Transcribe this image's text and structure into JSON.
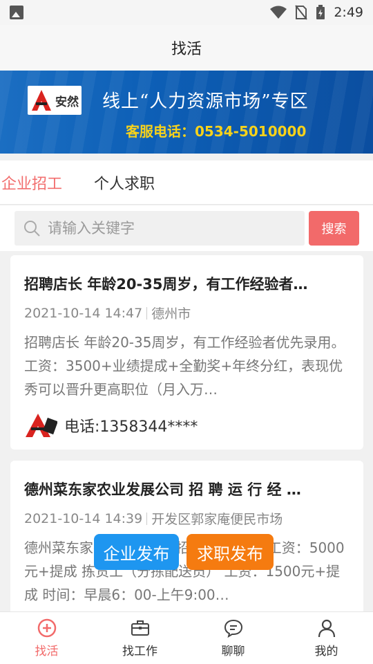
{
  "status_bar": {
    "time": "2:49"
  },
  "title": "找活",
  "banner": {
    "logo_text": "安然",
    "slogan": "线上“人力资源市场”专区",
    "phone": "客服电话：0534-5010000"
  },
  "tabs": [
    {
      "label": "企业招工",
      "active": true
    },
    {
      "label": "个人求职",
      "active": false
    }
  ],
  "search": {
    "placeholder": "请输入关键字",
    "button": "搜索"
  },
  "listings": [
    {
      "title": "招聘店长 年龄20-35周岁，有工作经验者…",
      "date": "2021-10-14 14:47",
      "location": "德州市",
      "description": "招聘店长 年龄20-35周岁，有工作经验者优先录用。 工资：3500+业绩提成+全勤奖+年终分红，表现优秀可以晋升更高职位（月入万…",
      "phone": "电话:1358344****"
    },
    {
      "title": "德州菜东家农业发展公司 招 聘 运 行 经 …",
      "date": "2021-10-14 14:39",
      "location": "开发区郭家庵便民市场",
      "description": "德州菜东家农业发展公司招聘运行经 理 工资：5000元+提成 拣货工（分拣配送员） 工资：1500元+提成 时间：早晨6：00-上午9:00…"
    }
  ],
  "fab": {
    "company": "企业发布",
    "job": "求职发布"
  },
  "nav": [
    {
      "label": "找活",
      "icon": "plus-circle-icon",
      "active": true
    },
    {
      "label": "找工作",
      "icon": "briefcase-icon",
      "active": false
    },
    {
      "label": "聊聊",
      "icon": "chat-bubble-icon",
      "active": false
    },
    {
      "label": "我的",
      "icon": "user-icon",
      "active": false
    }
  ],
  "colors": {
    "accent": "#f26a6a",
    "company_fab": "#1e96f0",
    "job_fab": "#f57b10",
    "banner": "#0d5fb6"
  }
}
